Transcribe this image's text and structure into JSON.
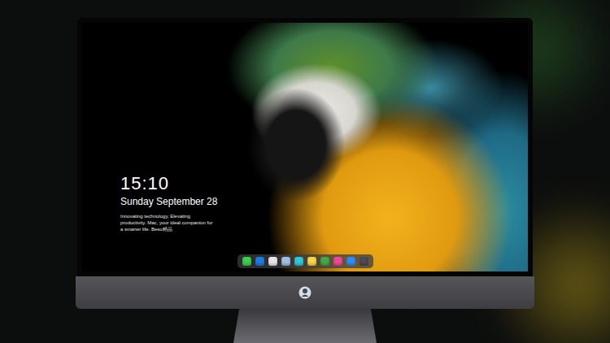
{
  "lock_screen": {
    "time": "15:10",
    "date": "Sunday September 28",
    "tagline": "Innovating technology, Elevating productivity. Mac, your ideal companion for a smarter life. Beso精品"
  },
  "wallpaper": {
    "kind": "photo"
  },
  "dock": {
    "items": [
      {
        "color": "#3ccf4e"
      },
      {
        "color": "#1e7be0"
      },
      {
        "color": "#e6e6e6"
      },
      {
        "color": "#9fbfe0"
      },
      {
        "color": "#2ec9d9"
      },
      {
        "color": "#f5d547"
      },
      {
        "color": "#43a84a"
      },
      {
        "color": "#e84a9a"
      },
      {
        "color": "#2f8cf0"
      },
      {
        "color": "#4a4a50"
      }
    ]
  }
}
